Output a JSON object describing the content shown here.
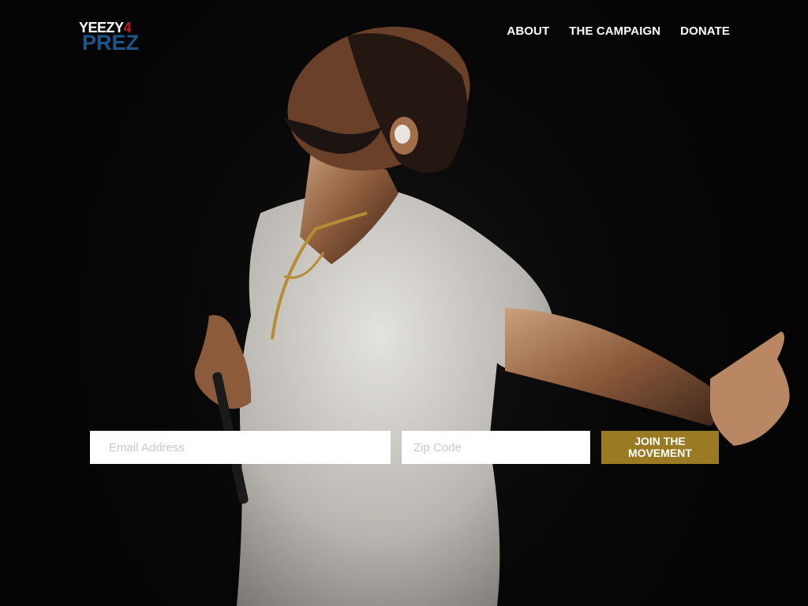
{
  "brand": {
    "line1": "YEEZY",
    "line1_suffix": "4",
    "line2": "PREZ",
    "colors": {
      "white": "#ffffff",
      "red": "#b51e23",
      "blue": "#1c5588"
    }
  },
  "nav": {
    "items": [
      {
        "label": "ABOUT"
      },
      {
        "label": "THE CAMPAIGN"
      },
      {
        "label": "DONATE"
      }
    ]
  },
  "signup": {
    "email_placeholder": "Email Address",
    "zip_placeholder": "Zip Code",
    "button_label": "JOIN THE MOVEMENT",
    "button_color": "#9a7a22"
  },
  "hero": {
    "image_subject": "performer-on-stage-arms-outstretched"
  }
}
